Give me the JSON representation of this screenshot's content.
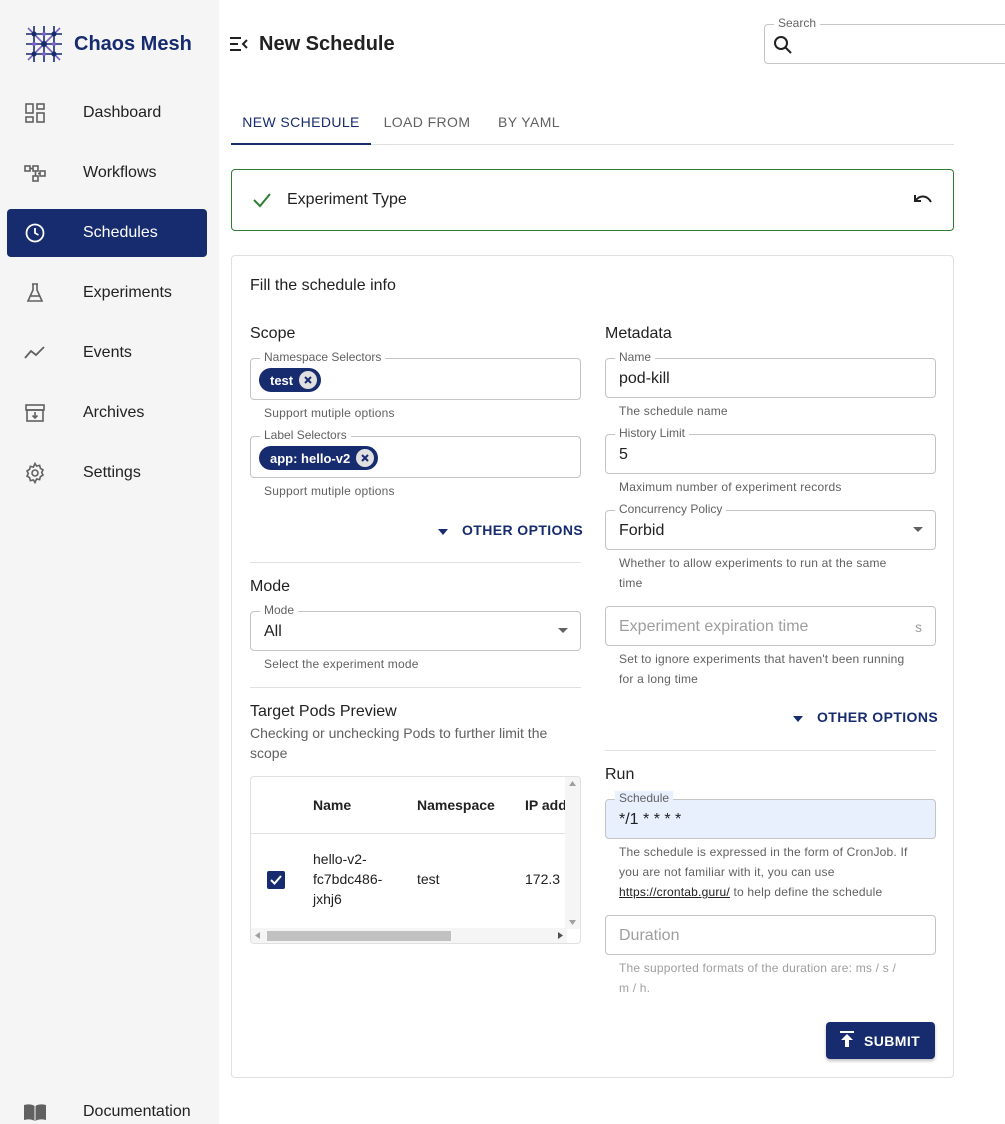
{
  "app": {
    "name": "Chaos Mesh"
  },
  "sidebar": {
    "items": [
      {
        "label": "Dashboard",
        "icon": "dashboard-icon",
        "active": false
      },
      {
        "label": "Workflows",
        "icon": "workflows-icon",
        "active": false
      },
      {
        "label": "Schedules",
        "icon": "clock-icon",
        "active": true
      },
      {
        "label": "Experiments",
        "icon": "flask-icon",
        "active": false
      },
      {
        "label": "Events",
        "icon": "timeline-icon",
        "active": false
      },
      {
        "label": "Archives",
        "icon": "archive-icon",
        "active": false
      },
      {
        "label": "Settings",
        "icon": "gear-icon",
        "active": false
      }
    ],
    "documentation": "Documentation"
  },
  "header": {
    "title": "New Schedule",
    "search_label": "Search"
  },
  "tabs": [
    {
      "label": "NEW SCHEDULE",
      "active": true
    },
    {
      "label": "LOAD FROM",
      "active": false
    },
    {
      "label": "BY YAML",
      "active": false
    }
  ],
  "experiment_type": {
    "label": "Experiment Type"
  },
  "form": {
    "heading": "Fill the schedule info",
    "scope": {
      "heading": "Scope",
      "namespace_label": "Namespace Selectors",
      "namespace_chips": [
        "test"
      ],
      "namespace_helper": "Support mutiple options",
      "label_label": "Label Selectors",
      "label_chips": [
        "app: hello-v2"
      ],
      "label_helper": "Support mutiple options",
      "other_options": "OTHER OPTIONS"
    },
    "mode": {
      "heading": "Mode",
      "label": "Mode",
      "value": "All",
      "helper": "Select the experiment mode"
    },
    "target_pods": {
      "heading": "Target Pods Preview",
      "description": "Checking or unchecking Pods to further limit the scope",
      "columns": [
        "Name",
        "Namespace",
        "IP add"
      ],
      "rows": [
        {
          "name_lines": [
            "hello-v2-",
            "fc7bdc486-",
            "jxhj6"
          ],
          "namespace": "test",
          "ip": "172.3",
          "checked": true
        }
      ]
    },
    "metadata": {
      "heading": "Metadata",
      "name_label": "Name",
      "name_value": "pod-kill",
      "name_helper": "The schedule name",
      "history_label": "History Limit",
      "history_value": "5",
      "history_helper": "Maximum number of experiment records",
      "concurrency_label": "Concurrency Policy",
      "concurrency_value": "Forbid",
      "concurrency_helper_1": "Whether to allow experiments to run at the same",
      "concurrency_helper_2": "time",
      "expiration_placeholder": "Experiment expiration time",
      "expiration_unit": "s",
      "expiration_helper_1": "Set to ignore experiments that haven't been running",
      "expiration_helper_2": "for a long time",
      "other_options": "OTHER OPTIONS"
    },
    "run": {
      "heading": "Run",
      "schedule_label": "Schedule",
      "schedule_value": "*/1 * * * *",
      "schedule_helper_1": "The schedule is expressed in the form of CronJob. If",
      "schedule_helper_2": "you are not familiar with it, you can use",
      "schedule_link": "https://crontab.guru/",
      "schedule_helper_3": " to help define the schedule",
      "duration_placeholder": "Duration",
      "duration_helper_1": "The supported formats of the duration are: ms / s /",
      "duration_helper_2": "m / h."
    },
    "submit": "SUBMIT"
  },
  "colors": {
    "primary": "#172b6f",
    "success": "#2e7d32",
    "sidebar_bg": "#f5f5f5",
    "schedule_bg": "#e8f0fe"
  }
}
